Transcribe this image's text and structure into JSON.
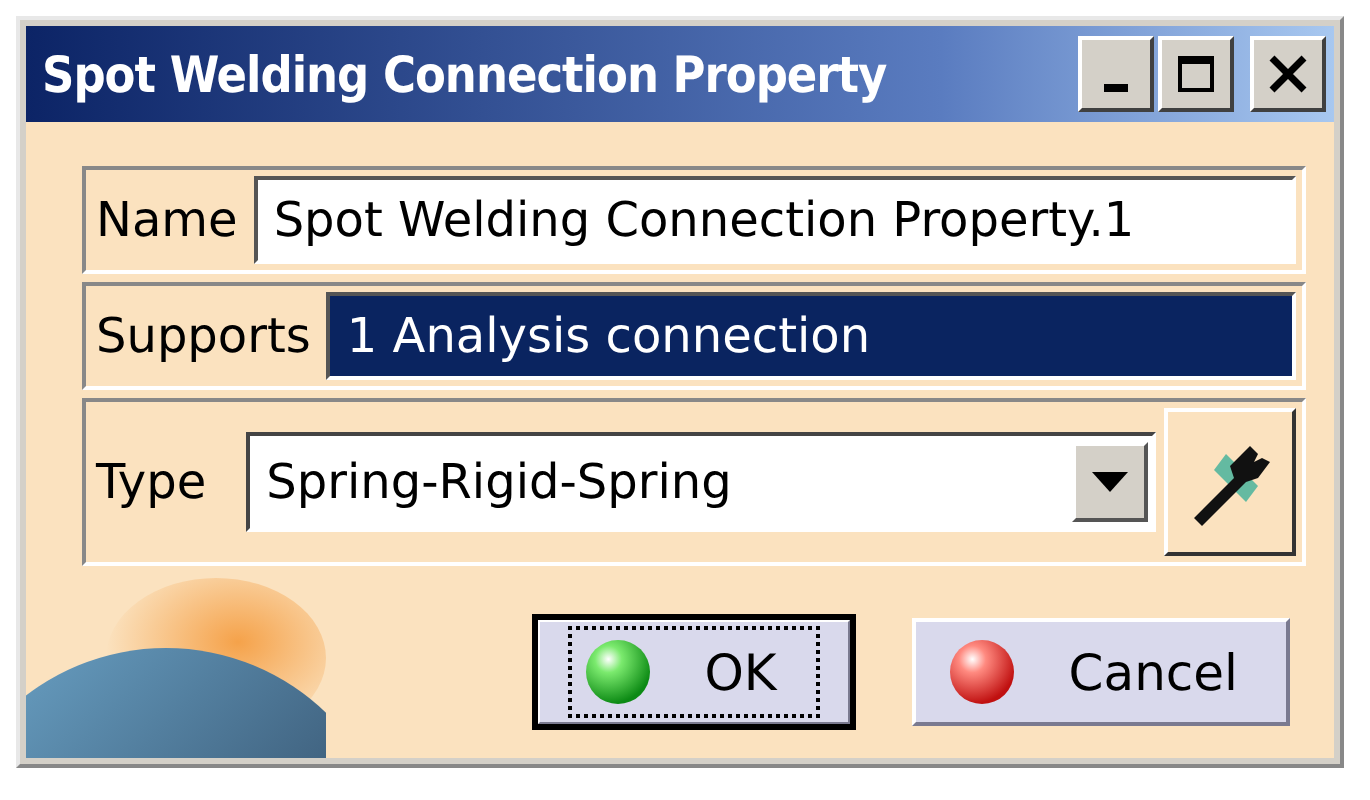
{
  "window": {
    "title": "Spot Welding Connection Property",
    "controls": [
      {
        "kind": "minimize"
      },
      {
        "kind": "maximize"
      },
      {
        "kind": "close"
      }
    ]
  },
  "name": {
    "label": "Name",
    "value": "Spot Welding Connection Property.1"
  },
  "supports": {
    "label": "Supports",
    "items": [
      {
        "text": "1 Analysis connection",
        "selected": true
      }
    ]
  },
  "type": {
    "label": "Type",
    "value": "Spring-Rigid-Spring"
  },
  "buttons": [
    {
      "label": "OK",
      "kind": "ok",
      "focused": true
    },
    {
      "label": "Cancel",
      "kind": "cancel",
      "focused": false
    }
  ]
}
